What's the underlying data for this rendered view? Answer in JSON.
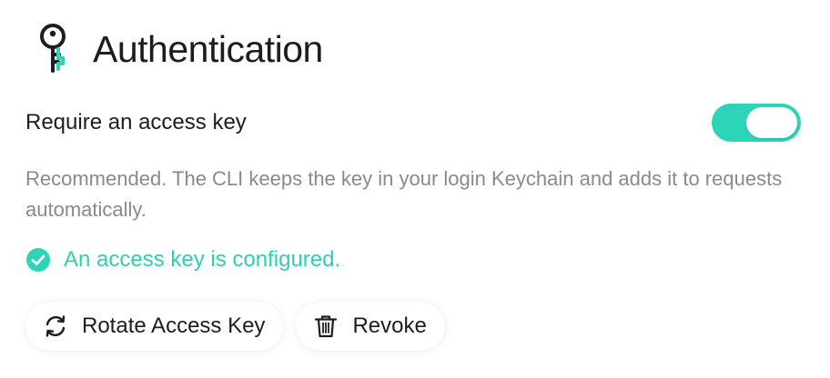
{
  "header": {
    "icon": "key-icon",
    "title": "Authentication"
  },
  "setting": {
    "label": "Require an access key",
    "toggle_on": true,
    "accent_color": "#2dd4b8"
  },
  "description": "Recommended. The CLI keeps the key in your login Keychain and adds it to requests automatically.",
  "status": {
    "icon": "check-circle-icon",
    "text": "An access key is configured.",
    "color": "#2dcfb3"
  },
  "actions": {
    "rotate": {
      "icon": "rotate-icon",
      "label": "Rotate Access Key"
    },
    "revoke": {
      "icon": "trash-icon",
      "label": "Revoke"
    }
  }
}
